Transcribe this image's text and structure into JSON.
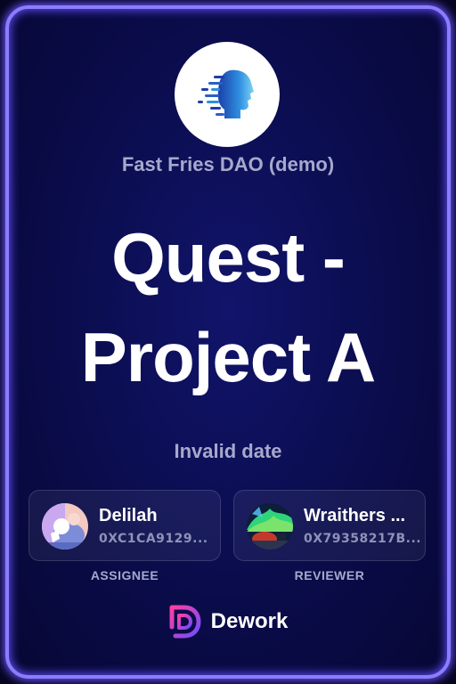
{
  "organization": {
    "name": "Fast Fries DAO (demo)",
    "logo_icon": "ai-head-logo-icon"
  },
  "task": {
    "title_line1": "Quest -",
    "title_line2": "Project A",
    "date": "Invalid date"
  },
  "assignee": {
    "name": "Delilah",
    "address": "0XC1CA9129...",
    "role": "ASSIGNEE",
    "avatar_icon": "cartoon-avatar-icon"
  },
  "reviewer": {
    "name": "Wraithers ...",
    "address": "0X79358217B...",
    "role": "REVIEWER",
    "avatar_icon": "aurora-avatar-icon"
  },
  "brand": {
    "name": "Dework",
    "logo_icon": "dework-logo-icon"
  },
  "colors": {
    "background": "#0a0c4b",
    "border_glow": "#8c7cff",
    "muted_text": "#a6a9cc",
    "brand_gradient_start": "#ff3fa4",
    "brand_gradient_end": "#6b4dff"
  }
}
